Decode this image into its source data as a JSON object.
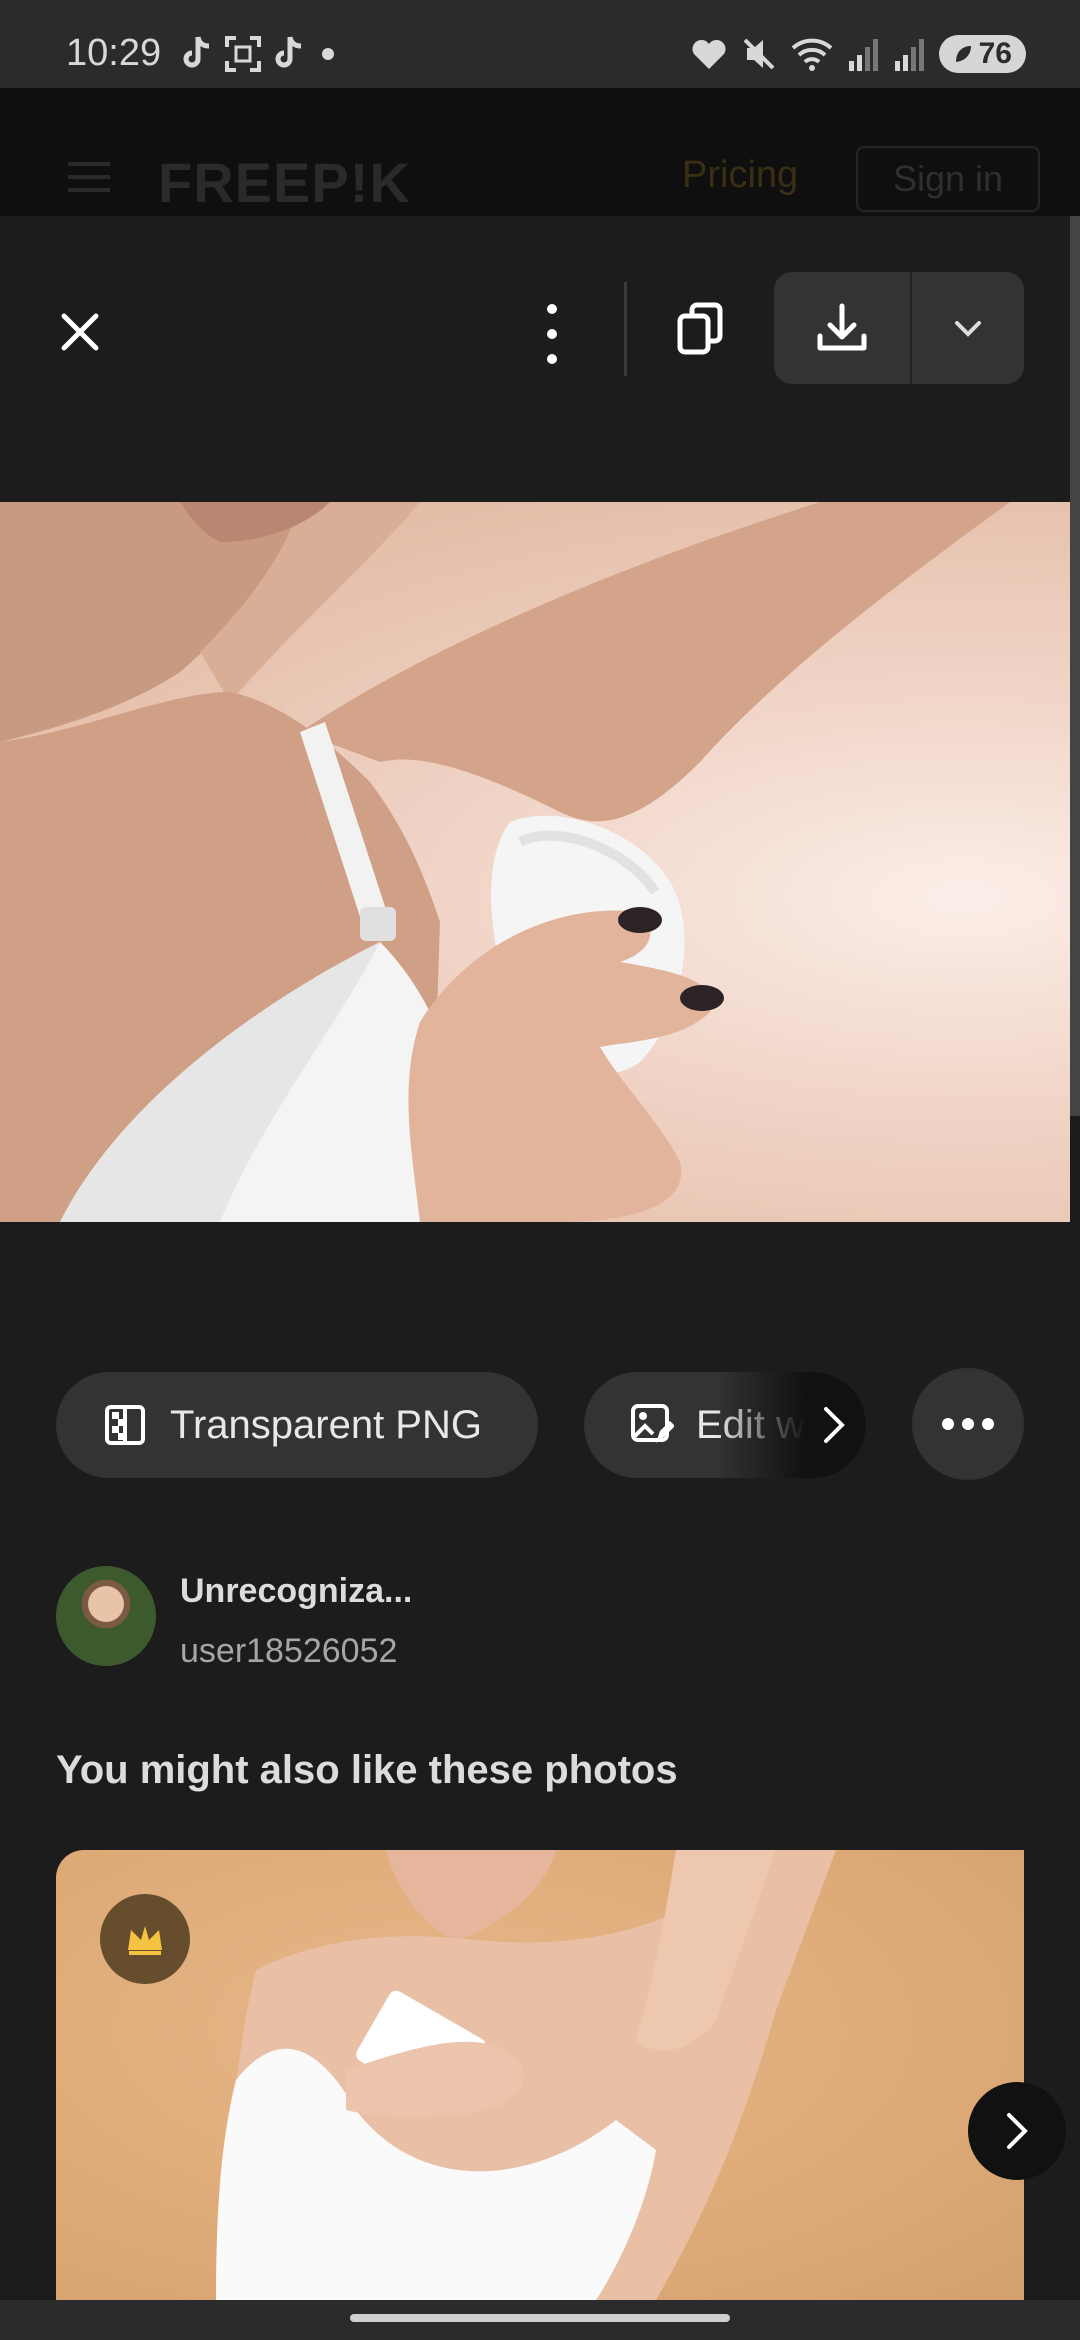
{
  "status_bar": {
    "time": "10:29",
    "battery": "76",
    "left_icons": [
      "tiktok-icon",
      "scan-icon",
      "tiktok-icon",
      "dot-icon"
    ],
    "right_icons": [
      "heart-icon",
      "mute-icon",
      "wifi-icon",
      "signal-icon",
      "signal-icon"
    ]
  },
  "background_header": {
    "logo": "FREEP!K",
    "pricing_label": "Pricing",
    "signin_label": "Sign in"
  },
  "toolbar": {
    "close_icon": "close-icon",
    "more_icon": "kebab-menu-icon",
    "copy_icon": "copy-icon",
    "download_icon": "download-icon",
    "dropdown_icon": "chevron-down-icon"
  },
  "actions": {
    "transparent_png_label": "Transparent PNG",
    "edit_label": "Edit w",
    "more_icon": "more-horizontal-icon"
  },
  "author": {
    "name": "Unrecogniza...",
    "username": "user18526052"
  },
  "related": {
    "title": "You might also like these photos"
  },
  "colors": {
    "background": "#1c1c1c",
    "chip": "#333333",
    "premium_crown": "#f5c242"
  }
}
